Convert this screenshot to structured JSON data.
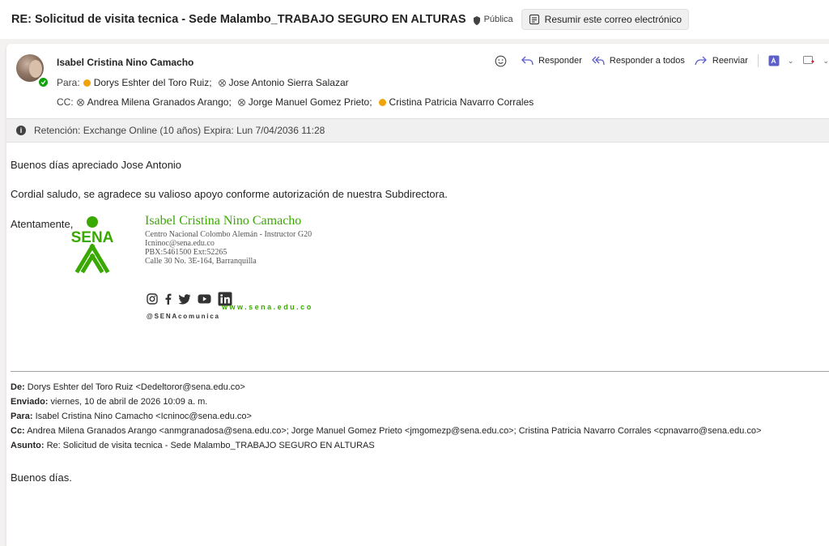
{
  "subject": {
    "title": "RE: Solicitud de visita tecnica - Sede Malambo_TRABAJO SEGURO EN ALTURAS",
    "sensitivity": "Pública",
    "summarize_label": "Resumir este correo electrónico"
  },
  "header": {
    "sender": "Isabel Cristina Nino Camacho",
    "to_label": "Para:",
    "to": [
      "Dorys Eshter del Toro Ruiz;",
      "Jose Antonio Sierra Salazar"
    ],
    "cc_label": "CC:",
    "cc": [
      "Andrea Milena Granados Arango;",
      "Jorge Manuel Gomez Prieto;",
      "Cristina Patricia Navarro Corrales"
    ],
    "actions": {
      "reply": "Responder",
      "reply_all": "Responder a todos",
      "forward": "Reenviar"
    }
  },
  "retention": "Retención: Exchange Online (10 años) Expira: Lun 7/04/2036 11:28",
  "body": {
    "greeting": "Buenos días apreciado Jose Antonio",
    "message": "Cordial saludo, se agradece su valioso apoyo conforme autorización de nuestra Subdirectora.",
    "closing": "Atentamente,"
  },
  "signature": {
    "logo_text": "SENA",
    "name": "Isabel Cristina Nino Camacho",
    "role": "Centro Nacional Colombo Alemán - Instructor G20",
    "email": "Icninoc@sena.edu.co",
    "phone": "PBX:5461500 Ext:52265",
    "address": "Calle 30 No. 3E-164, Barranquilla",
    "web": "www.sena.edu.co",
    "handle": "@SENAcomunica",
    "socials": [
      "instagram-icon",
      "facebook-icon",
      "twitter-icon",
      "youtube-icon",
      "linkedin-icon"
    ],
    "green": "#39a900"
  },
  "forwarded": {
    "from_label": "De:",
    "from": "Dorys Eshter del Toro Ruiz <Dedeltoror@sena.edu.co>",
    "sent_label": "Enviado:",
    "sent": "viernes, 10 de abril de 2026 10:09 a. m.",
    "to_label": "Para:",
    "to": "Isabel Cristina Nino Camacho <Icninoc@sena.edu.co>",
    "cc_label": "Cc:",
    "cc": "Andrea Milena Granados Arango <anmgranadosa@sena.edu.co>; Jorge Manuel Gomez Prieto <jmgomezp@sena.edu.co>; Cristina Patricia Navarro Corrales <cpnavarro@sena.edu.co>",
    "subject_label": "Asunto:",
    "subject": "Re: Solicitud de visita tecnica - Sede Malambo_TRABAJO SEGURO EN ALTURAS",
    "greeting": "Buenos días."
  }
}
